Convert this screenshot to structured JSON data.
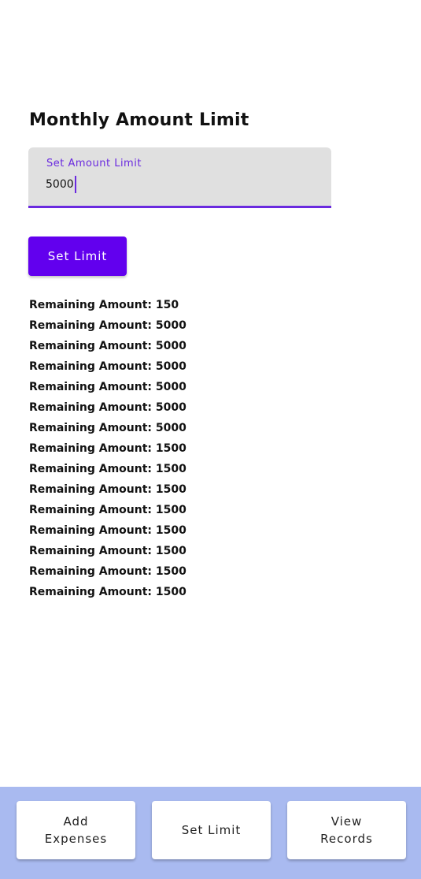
{
  "page": {
    "title": "Monthly Amount Limit"
  },
  "limit_field": {
    "label": "Set Amount Limit",
    "value": "5000"
  },
  "set_limit_button": {
    "label": "Set Limit"
  },
  "records": [
    "Remaining Amount: 150",
    "Remaining Amount: 5000",
    "Remaining Amount: 5000",
    "Remaining Amount: 5000",
    "Remaining Amount: 5000",
    "Remaining Amount: 5000",
    "Remaining Amount: 5000",
    "Remaining Amount: 1500",
    "Remaining Amount: 1500",
    "Remaining Amount: 1500",
    "Remaining Amount: 1500",
    "Remaining Amount: 1500",
    "Remaining Amount: 1500",
    "Remaining Amount: 1500",
    "Remaining Amount: 1500"
  ],
  "bottom_nav": {
    "add_expenses": [
      "Add",
      "Expenses"
    ],
    "set_limit": [
      "Set Limit"
    ],
    "view_records": [
      "View",
      "Records"
    ]
  },
  "colors": {
    "accent": "#6200ee",
    "field_underline": "#6a2adf",
    "bottom_bar": "#a9baf0"
  }
}
